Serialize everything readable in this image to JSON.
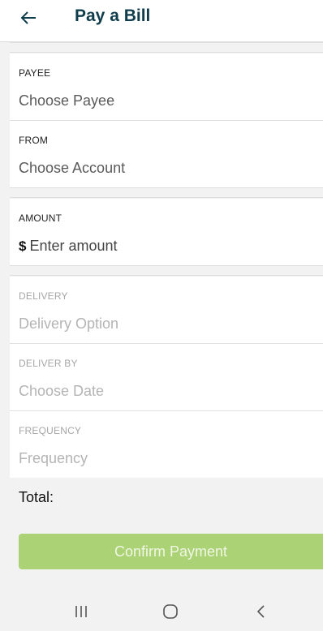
{
  "header": {
    "title": "Pay a Bill",
    "back_icon": "arrow-left-icon"
  },
  "form": {
    "payee": {
      "label": "PAYEE",
      "placeholder": "Choose Payee"
    },
    "from": {
      "label": "FROM",
      "placeholder": "Choose Account"
    },
    "amount": {
      "label": "AMOUNT",
      "currency": "$",
      "placeholder": "Enter amount"
    },
    "delivery": {
      "label": "DELIVERY",
      "placeholder": "Delivery Option"
    },
    "deliver_by": {
      "label": "DELIVER BY",
      "placeholder": "Choose Date"
    },
    "frequency": {
      "label": "FREQUENCY",
      "placeholder": "Frequency"
    }
  },
  "summary": {
    "total_label": "Total:",
    "confirm_label": "Confirm Payment"
  },
  "system_nav": {
    "recents_icon": "recents-icon",
    "home_icon": "home-icon",
    "back_icon": "chevron-left-icon"
  },
  "colors": {
    "title": "#0f3d4c",
    "confirm_button": "#acd276",
    "background": "#f2f2f2"
  }
}
